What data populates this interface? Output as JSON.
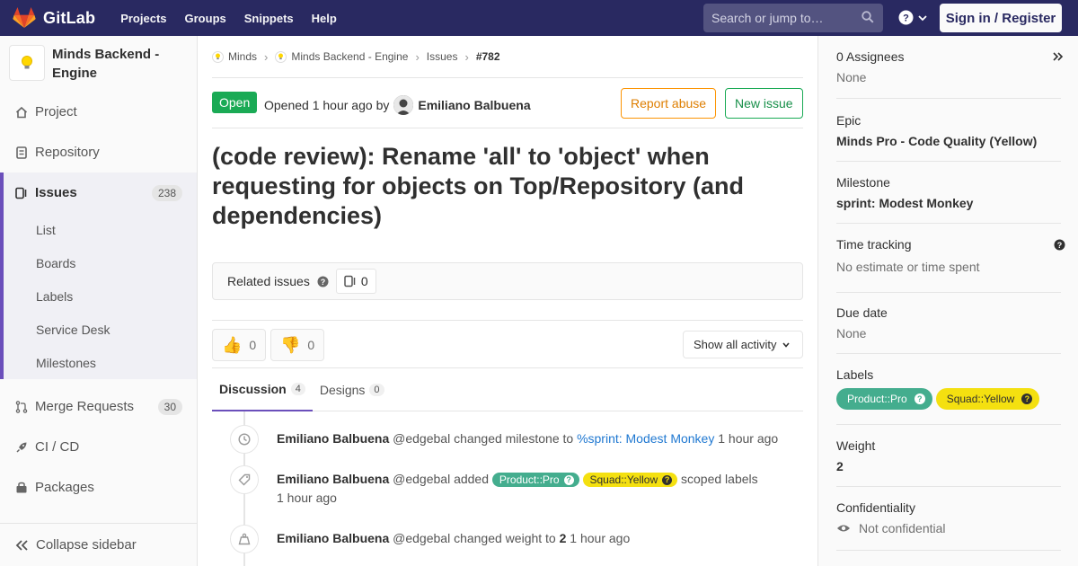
{
  "navbar": {
    "brand": "GitLab",
    "links": [
      "Projects",
      "Groups",
      "Snippets",
      "Help"
    ],
    "search_placeholder": "Search or jump to…",
    "sign_in": "Sign in / Register"
  },
  "sidebar": {
    "project_name": "Minds Backend - Engine",
    "items": {
      "project": "Project",
      "repository": "Repository",
      "issues": "Issues",
      "issues_count": "238",
      "merge_requests": "Merge Requests",
      "merge_requests_count": "30",
      "cicd": "CI / CD",
      "packages": "Packages"
    },
    "issues_sub": [
      "List",
      "Boards",
      "Labels",
      "Service Desk",
      "Milestones"
    ],
    "collapse": "Collapse sidebar"
  },
  "breadcrumb": [
    "Minds",
    "Minds Backend - Engine",
    "Issues",
    "#782"
  ],
  "issue": {
    "status": "Open",
    "opened": "Opened",
    "time": "1 hour ago",
    "by": "by",
    "author": "Emiliano Balbuena",
    "report_abuse": "Report abuse",
    "new_issue": "New issue",
    "title": "(code review): Rename 'all' to 'object' when requesting for objects on Top/Repository (and dependencies)"
  },
  "related": {
    "label": "Related issues",
    "count": "0"
  },
  "awards": {
    "thumbs_up": "0",
    "thumbs_down": "0"
  },
  "activity_filter": "Show all activity",
  "tabs": [
    {
      "label": "Discussion",
      "count": "4"
    },
    {
      "label": "Designs",
      "count": "0"
    }
  ],
  "timeline": [
    {
      "author": "Emiliano Balbuena",
      "handle": "@edgebal",
      "action": "changed milestone to",
      "link": "%sprint: Modest Monkey",
      "time": "1 hour ago"
    },
    {
      "author": "Emiliano Balbuena",
      "handle": "@edgebal",
      "action": "added",
      "labels": [
        "Product::Pro",
        "Squad::Yellow"
      ],
      "suffix": "scoped labels",
      "time": "1 hour ago"
    },
    {
      "author": "Emiliano Balbuena",
      "handle": "@edgebal",
      "action": "changed weight to",
      "value": "2",
      "time": "1 hour ago"
    }
  ],
  "right_sidebar": {
    "assignees_title": "0 Assignees",
    "assignees_value": "None",
    "epic_title": "Epic",
    "epic_value": "Minds Pro - Code Quality (Yellow)",
    "milestone_title": "Milestone",
    "milestone_value": "sprint: Modest Monkey",
    "time_tracking_title": "Time tracking",
    "time_tracking_value": "No estimate or time spent",
    "due_date_title": "Due date",
    "due_date_value": "None",
    "labels_title": "Labels",
    "labels": [
      "Product::Pro",
      "Squad::Yellow"
    ],
    "weight_title": "Weight",
    "weight_value": "2",
    "confidentiality_title": "Confidentiality",
    "confidentiality_value": "Not confidential"
  },
  "colors": {
    "navbar": "#292961",
    "open_badge": "#1aaa55",
    "label_product_pro": "#44ad8e",
    "label_squad_yellow": "#f4e010",
    "accent": "#6b4fbb"
  }
}
